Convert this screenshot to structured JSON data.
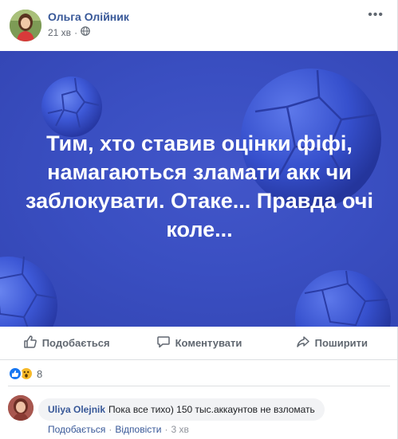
{
  "post": {
    "author": "Ольга Олійник",
    "time": "21 хв",
    "privacy_icon": "globe-icon",
    "banner_text": "Тим, хто ставив оцінки фіфі, намагаються зламати акк чи заблокувати. Отаке... Правда очі коле...",
    "banner_color": "#3a4fc2"
  },
  "actions": {
    "like_label": "Подобається",
    "comment_label": "Коментувати",
    "share_label": "Поширити"
  },
  "reactions": {
    "types": [
      "like",
      "wow"
    ],
    "count": "8"
  },
  "comment": {
    "author": "Uliya Olejnik",
    "text": "Пока все тихо) 150 тыс.аккаунтов не взломать",
    "like_label": "Подобається",
    "reply_label": "Відповісти",
    "time": "3 хв",
    "separator": "·"
  },
  "colors": {
    "link": "#385898",
    "secondary": "#606770"
  }
}
